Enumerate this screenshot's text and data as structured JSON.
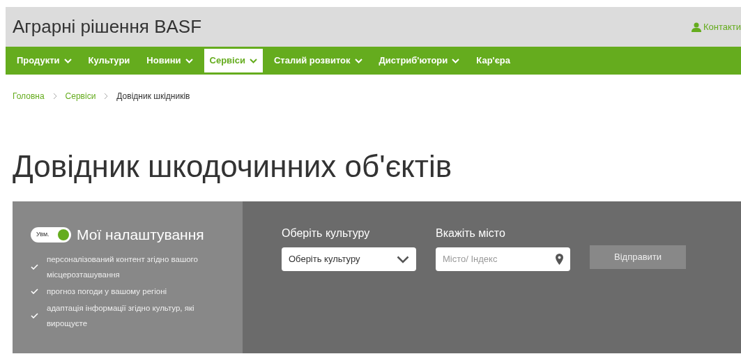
{
  "header": {
    "title": "Аграрні рішення BASF",
    "contacts_link": "Контакти"
  },
  "nav": [
    {
      "label": "Продукти",
      "has_menu": true,
      "selected": false
    },
    {
      "label": "Культури",
      "has_menu": false,
      "selected": false
    },
    {
      "label": "Новини",
      "has_menu": true,
      "selected": false
    },
    {
      "label": "Сервіси",
      "has_menu": true,
      "selected": true
    },
    {
      "label": "Сталий розвиток",
      "has_menu": true,
      "selected": false
    },
    {
      "label": "Дистриб'ютори",
      "has_menu": true,
      "selected": false
    },
    {
      "label": "Кар'єра",
      "has_menu": false,
      "selected": false
    }
  ],
  "breadcrumb": [
    {
      "label": "Головна",
      "link": true
    },
    {
      "label": "Сервіси",
      "link": true
    },
    {
      "label": "Довідник шкідників",
      "link": false
    }
  ],
  "page_title": "Довідник шкодочинних об'єктів",
  "settings": {
    "toggle_label": "Увм.",
    "on": true,
    "title": "Мої налаштування",
    "benefits": [
      "персоналізований контент згідно вашого місцерозташування",
      "прогноз погоди у вашому регіоні",
      "адаптація інформації згідно культур, які вирощуєте"
    ]
  },
  "form": {
    "culture_label": "Оберіть культуру",
    "culture_value": "Оберіть культуру",
    "city_label": "Вкажіть місто",
    "city_placeholder": "Місто/ Індекс",
    "submit": "Відправити"
  }
}
